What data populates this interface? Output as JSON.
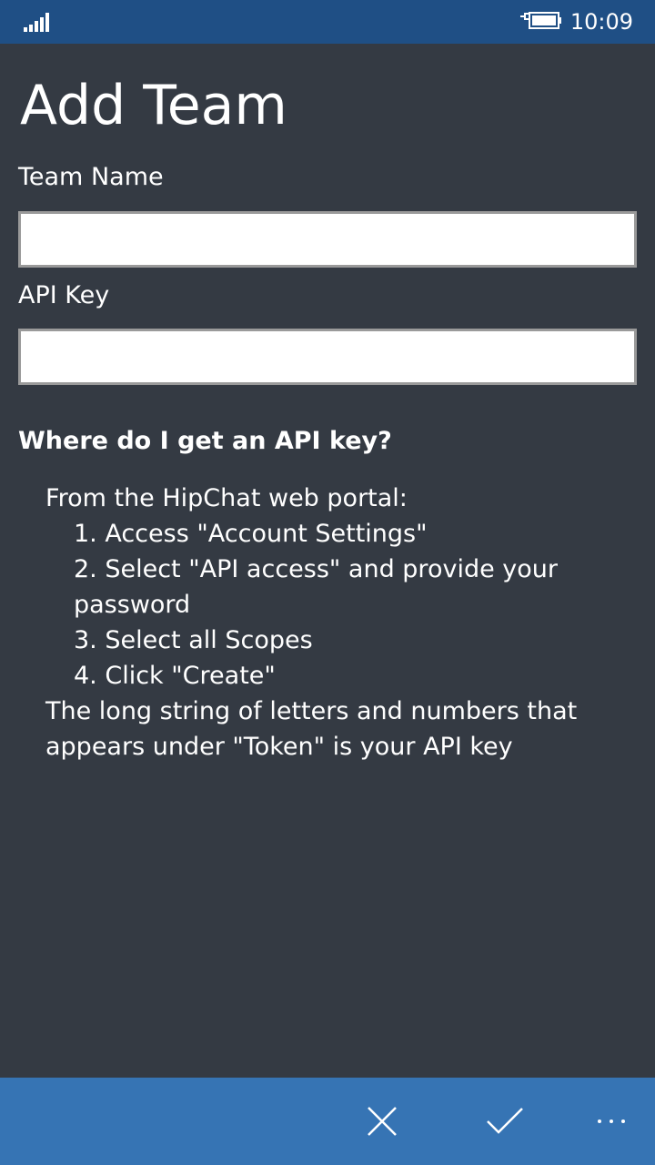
{
  "status_bar": {
    "time": "10:09",
    "signal_icon": "signal-bars-icon",
    "battery_icon": "battery-charging-icon"
  },
  "page": {
    "title": "Add Team"
  },
  "form": {
    "team_name_label": "Team Name",
    "team_name_value": "",
    "api_key_label": "API Key",
    "api_key_value": ""
  },
  "help": {
    "heading": "Where do I get an API key?",
    "intro": "From the HipChat web portal:",
    "steps": [
      "1. Access \"Account Settings\"",
      "2. Select \"API access\" and provide your password",
      "3. Select all Scopes",
      "4. Click \"Create\""
    ],
    "outro": "The long string of letters and numbers that appears under \"Token\" is your API key"
  },
  "app_bar": {
    "buttons": [
      {
        "icon": "close-icon"
      },
      {
        "icon": "checkmark-icon"
      },
      {
        "icon": "more-icon"
      }
    ]
  },
  "colors": {
    "status_bar": "#1f4f85",
    "background": "#343a43",
    "app_bar": "#3674b4"
  }
}
